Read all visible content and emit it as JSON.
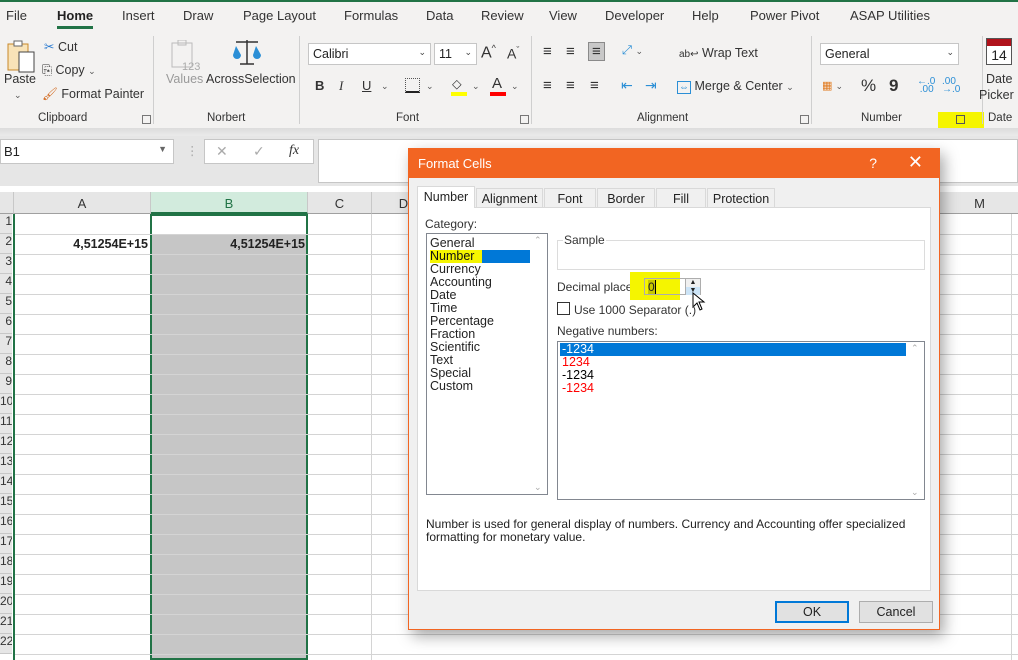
{
  "ribbon_tabs": [
    {
      "label": "File",
      "active": false
    },
    {
      "label": "Home",
      "active": true
    },
    {
      "label": "Insert",
      "active": false
    },
    {
      "label": "Draw",
      "active": false
    },
    {
      "label": "Page Layout",
      "active": false
    },
    {
      "label": "Formulas",
      "active": false
    },
    {
      "label": "Data",
      "active": false
    },
    {
      "label": "Review",
      "active": false
    },
    {
      "label": "View",
      "active": false
    },
    {
      "label": "Developer",
      "active": false
    },
    {
      "label": "Help",
      "active": false
    },
    {
      "label": "Power Pivot",
      "active": false
    },
    {
      "label": "ASAP Utilities",
      "active": false
    }
  ],
  "clipboard": {
    "group": "Clipboard",
    "paste": "Paste",
    "cut": "Cut",
    "copy": "Copy",
    "format_painter": "Format Painter"
  },
  "norbert": {
    "group": "Norbert",
    "values": "Values",
    "across": "AcrossSelection",
    "values_icon_text": "123"
  },
  "font": {
    "group": "Font",
    "name": "Calibri",
    "size": "11",
    "bold": "B",
    "italic": "I",
    "underline": "U",
    "grow": "A",
    "shrink": "A",
    "color_letter": "A",
    "fill_color": "#ffff00",
    "font_color": "#ff0000"
  },
  "alignment": {
    "group": "Alignment",
    "wrap": "Wrap Text",
    "merge": "Merge & Center"
  },
  "number": {
    "group": "Number",
    "format": "General",
    "percent": "%",
    "comma": "9"
  },
  "date": {
    "group": "Date",
    "picker_line1": "Date",
    "picker_line2": "Picker",
    "day": "14"
  },
  "formula_bar": {
    "name_box": "B1",
    "fx": "fx",
    "cancel": "✕",
    "enter": "✓",
    "value": ""
  },
  "sheet": {
    "columns": [
      "A",
      "B",
      "C",
      "D",
      "M"
    ],
    "rows": [
      "1",
      "2",
      "3",
      "4",
      "5",
      "6",
      "7",
      "8",
      "9",
      "10",
      "11",
      "12",
      "13",
      "14",
      "15",
      "16",
      "17",
      "18",
      "19",
      "20",
      "21",
      "22"
    ],
    "cells": {
      "A2": "4,51254E+15",
      "B2": "4,51254E+15"
    },
    "selected_column": "B"
  },
  "dialog": {
    "title": "Format Cells",
    "help": "?",
    "close": "✕",
    "tabs": [
      "Number",
      "Alignment",
      "Font",
      "Border",
      "Fill",
      "Protection"
    ],
    "active_tab": "Number",
    "category_label": "Category:",
    "categories": [
      "General",
      "Number",
      "Currency",
      "Accounting",
      "Date",
      "Time",
      "Percentage",
      "Fraction",
      "Scientific",
      "Text",
      "Special",
      "Custom"
    ],
    "selected_category": "Number",
    "sample_label": "Sample",
    "decimal_label": "Decimal places:",
    "decimal_value": "0",
    "separator_label": "Use 1000 Separator (.)",
    "separator_checked": false,
    "negative_label": "Negative numbers:",
    "negative_options": [
      {
        "text": "-1234",
        "color": "#000000",
        "selected": true
      },
      {
        "text": "1234",
        "color": "#ff0000",
        "selected": false
      },
      {
        "text": "-1234",
        "color": "#000000",
        "selected": false
      },
      {
        "text": "-1234",
        "color": "#ff0000",
        "selected": false
      }
    ],
    "description": "Number is used for general display of numbers.  Currency and Accounting offer specialized formatting for monetary value.",
    "ok": "OK",
    "cancel": "Cancel"
  },
  "colors": {
    "excel_green": "#217346",
    "dialog_orange": "#f26522",
    "highlight": "#f5f500",
    "selection_blue": "#0078d7"
  }
}
